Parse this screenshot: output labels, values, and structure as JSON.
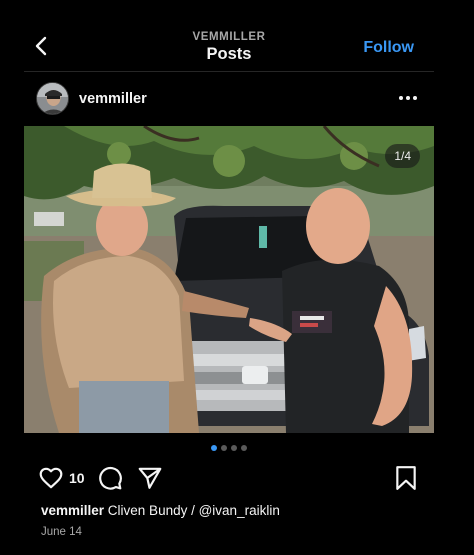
{
  "header": {
    "account_label": "VEMMILLER",
    "title": "Posts",
    "follow_label": "Follow"
  },
  "post": {
    "username": "vemmiller",
    "image_counter": "1/4",
    "carousel": {
      "total_dots": 4,
      "active_index": 0
    },
    "likes": "10",
    "caption_user": "vemmiller",
    "caption_text": " Cliven Bundy / @ivan_raiklin",
    "date": "June 14"
  },
  "icons": {
    "back": "chevron-left-icon",
    "more": "more-horizontal-icon",
    "like": "heart-icon",
    "comment": "comment-icon",
    "share": "send-icon",
    "save": "bookmark-icon"
  },
  "colors": {
    "background": "#000000",
    "accent": "#3a98f5",
    "text": "#f5f5f5",
    "muted": "#a8a8a8"
  }
}
